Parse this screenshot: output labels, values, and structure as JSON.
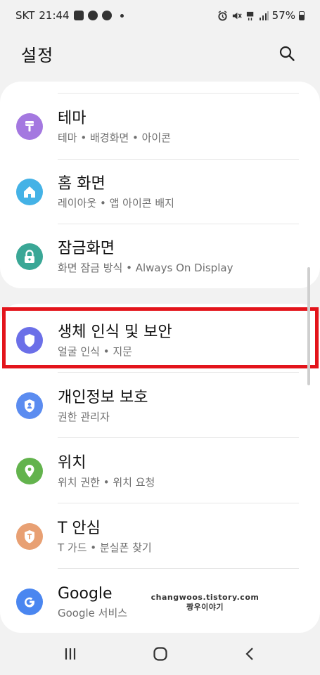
{
  "status": {
    "carrier": "SKT",
    "time": "21:44",
    "battery": "57%",
    "icons_left": [
      "gallery-icon",
      "chat-icon",
      "alert-icon",
      "dot-icon"
    ],
    "icons_right": [
      "alarm-icon",
      "mute-icon",
      "lte-icon",
      "signal-icon",
      "battery-icon"
    ]
  },
  "header": {
    "title": "설정",
    "search_icon": "search-icon"
  },
  "settings": [
    {
      "title": "테마",
      "subtitle": "테마 • 배경화면 • 아이콘",
      "icon": "theme-brush-icon",
      "color": "#a478e0"
    },
    {
      "title": "홈 화면",
      "subtitle": "레이아웃 • 앱 아이콘 배지",
      "icon": "home-icon",
      "color": "#44b2e6"
    },
    {
      "title": "잠금화면",
      "subtitle": "화면 잠금 방식 • Always On Display",
      "icon": "lock-icon",
      "color": "#3aa796"
    },
    {
      "title": "생체 인식 및 보안",
      "subtitle": "얼굴 인식 • 지문",
      "icon": "shield-icon",
      "color": "#6b6fe8"
    },
    {
      "title": "개인정보 보호",
      "subtitle": "권한 관리자",
      "icon": "privacy-shield-icon",
      "color": "#5b8cf0"
    },
    {
      "title": "위치",
      "subtitle": "위치 권한 • 위치 요청",
      "icon": "location-pin-icon",
      "color": "#63b34d"
    },
    {
      "title": "T 안심",
      "subtitle": "T 가드 • 분실폰 찾기",
      "icon": "t-guard-icon",
      "color": "#e8a073"
    },
    {
      "title": "Google",
      "subtitle": "Google 서비스",
      "icon": "google-icon",
      "color": "#4a86f0"
    }
  ],
  "watermark": {
    "line1": "changwoos.tistory.com",
    "line2": "짱우이야기"
  },
  "navigation": {
    "recent": "recent-apps-icon",
    "home": "home-button-icon",
    "back": "back-icon"
  }
}
